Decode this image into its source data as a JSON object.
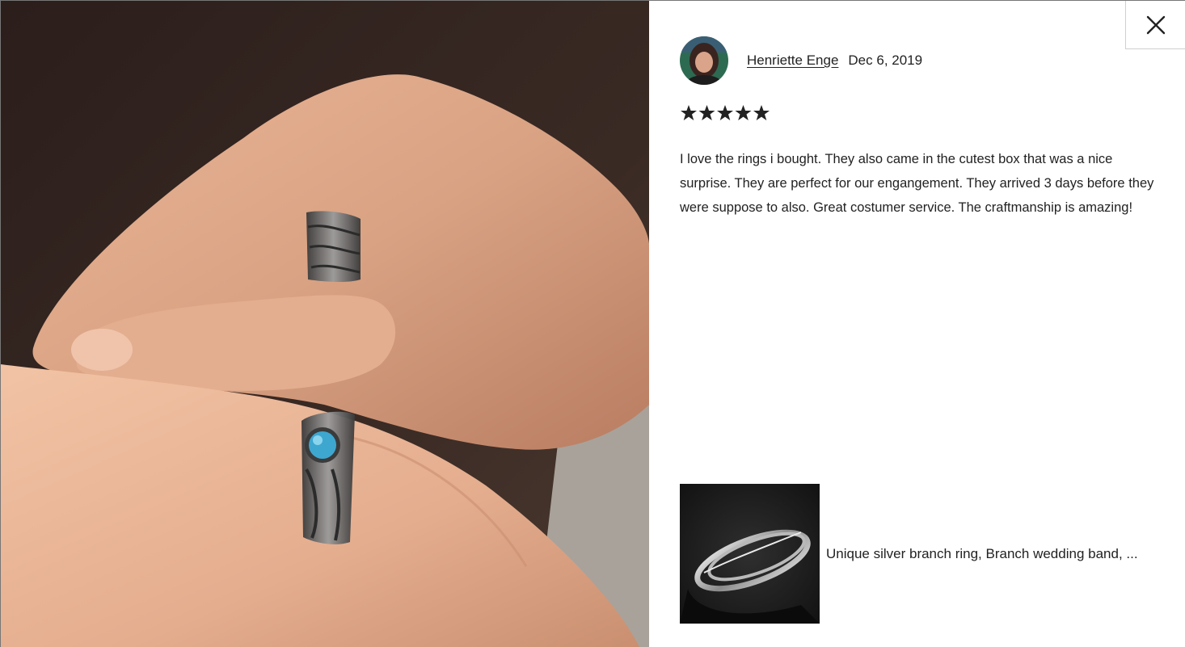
{
  "close_button": {
    "icon": "close-icon"
  },
  "review": {
    "reviewer_name": "Henriette Enge",
    "date": "Dec 6, 2019",
    "rating": 5,
    "max_rating": 5,
    "star_symbol": "★",
    "text": "I love the rings i bought. They also came in the cutest box that was a nice surprise. They are perfect for our engangement. They arrived 3 days before they were suppose to also. Great costumer service. The craftmanship is amazing!"
  },
  "item": {
    "title": "Unique silver branch ring, Branch wedding band, ..."
  },
  "colors": {
    "text": "#222222",
    "star": "#222222",
    "border": "#cfcfcf"
  }
}
